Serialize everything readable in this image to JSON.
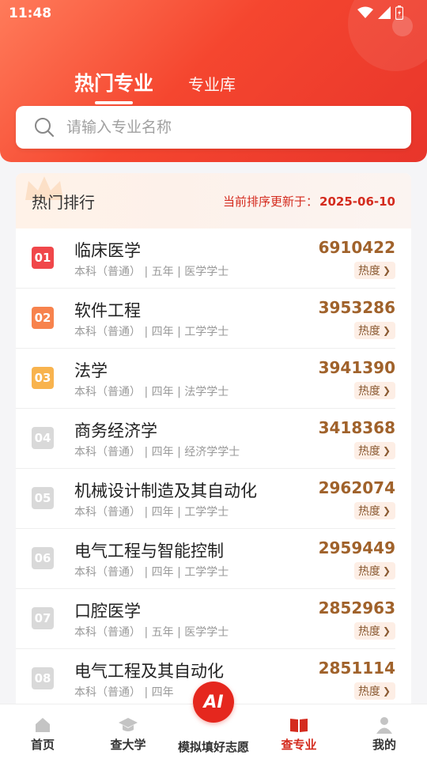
{
  "status_bar": {
    "time": "11:48"
  },
  "header": {
    "tabs": [
      {
        "label": "热门专业",
        "active": true
      },
      {
        "label": "专业库",
        "active": false
      }
    ],
    "search": {
      "placeholder": "请输入专业名称"
    }
  },
  "ranking": {
    "title": "热门排行",
    "updated_label": "当前排序更新于：",
    "updated_date": "2025-06-10",
    "heat_label": "热度",
    "items": [
      {
        "rank": "01",
        "name": "临床医学",
        "level": "本科（普通）",
        "years": "五年",
        "degree": "医学学士",
        "score": "6910422",
        "badge_color": "#f0474a"
      },
      {
        "rank": "02",
        "name": "软件工程",
        "level": "本科（普通）",
        "years": "四年",
        "degree": "工学学士",
        "score": "3953286",
        "badge_color": "#f7834d"
      },
      {
        "rank": "03",
        "name": "法学",
        "level": "本科（普通）",
        "years": "四年",
        "degree": "法学学士",
        "score": "3941390",
        "badge_color": "#f8b34e"
      },
      {
        "rank": "04",
        "name": "商务经济学",
        "level": "本科（普通）",
        "years": "四年",
        "degree": "经济学学士",
        "score": "3418368",
        "badge_color": "#d9d9d9"
      },
      {
        "rank": "05",
        "name": "机械设计制造及其自动化",
        "level": "本科（普通）",
        "years": "四年",
        "degree": "工学学士",
        "score": "2962074",
        "badge_color": "#d9d9d9"
      },
      {
        "rank": "06",
        "name": "电气工程与智能控制",
        "level": "本科（普通）",
        "years": "四年",
        "degree": "工学学士",
        "score": "2959449",
        "badge_color": "#d9d9d9"
      },
      {
        "rank": "07",
        "name": "口腔医学",
        "level": "本科（普通）",
        "years": "五年",
        "degree": "医学学士",
        "score": "2852963",
        "badge_color": "#d9d9d9"
      },
      {
        "rank": "08",
        "name": "电气工程及其自动化",
        "level": "本科（普通）",
        "years": "四年",
        "degree": "",
        "score": "2851114",
        "badge_color": "#d9d9d9"
      }
    ]
  },
  "tab_bar": {
    "items": [
      {
        "label": "首页",
        "icon": "home-icon",
        "active": false
      },
      {
        "label": "查大学",
        "icon": "graduation-cap-icon",
        "active": false
      },
      {
        "label": "模拟填好志愿",
        "icon": "ai-icon",
        "active": false
      },
      {
        "label": "查专业",
        "icon": "book-icon",
        "active": true
      },
      {
        "label": "我的",
        "icon": "person-icon",
        "active": false
      }
    ],
    "ai_text": "AI"
  },
  "colors": {
    "brand_red": "#e5271e",
    "score_brown": "#a0622b",
    "updated_red": "#d42b1e"
  }
}
